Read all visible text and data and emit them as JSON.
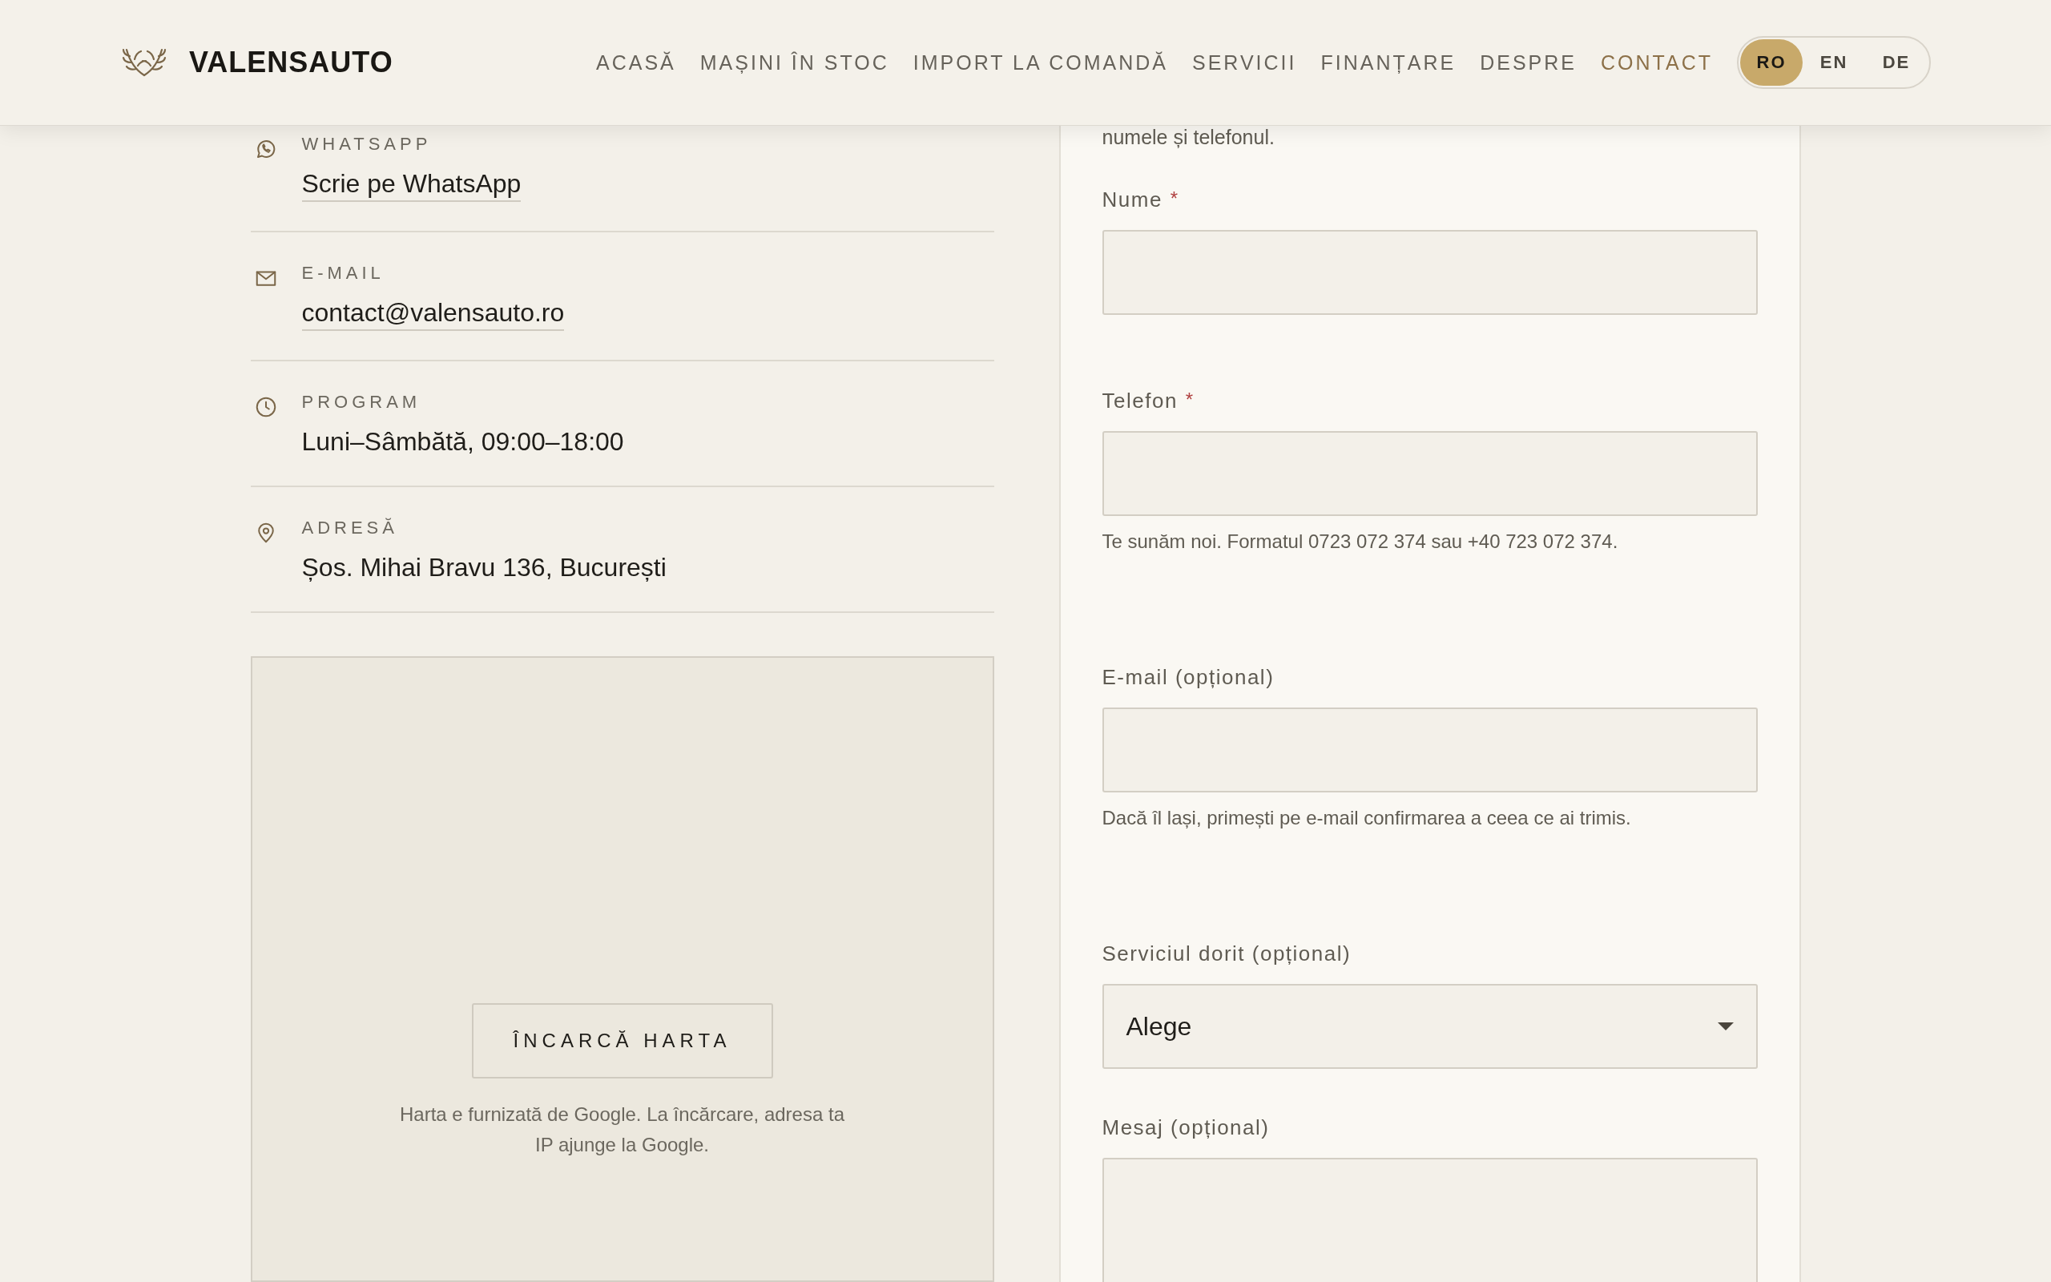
{
  "header": {
    "brand": "VALENSAUTO",
    "nav": [
      {
        "label": "ACASĂ",
        "selected": false
      },
      {
        "label": "MAȘINI ÎN STOC",
        "selected": false
      },
      {
        "label": "IMPORT LA COMANDĂ",
        "selected": false
      },
      {
        "label": "SERVICII",
        "selected": false
      },
      {
        "label": "FINANȚARE",
        "selected": false
      },
      {
        "label": "DESPRE",
        "selected": false
      },
      {
        "label": "CONTACT",
        "selected": true
      }
    ],
    "languages": [
      {
        "label": "RO",
        "selected": true
      },
      {
        "label": "EN",
        "selected": false
      },
      {
        "label": "DE",
        "selected": false
      }
    ]
  },
  "contact_items": [
    {
      "kind": "whatsapp",
      "label": "WHATSAPP",
      "value": "Scrie pe WhatsApp",
      "link": true
    },
    {
      "kind": "email",
      "label": "E-MAIL",
      "value": "contact@valensauto.ro",
      "link": true
    },
    {
      "kind": "clock",
      "label": "PROGRAM",
      "value": "Luni–Sâmbătă, 09:00–18:00",
      "link": false
    },
    {
      "kind": "pin",
      "label": "ADRESĂ",
      "value": "Șos. Mihai Bravu 136, București",
      "link": false
    }
  ],
  "map": {
    "button": "ÎNCARCĂ HARTA",
    "note": "Harta e furnizată de Google. La încărcare, adresa ta IP ajunge la Google."
  },
  "form": {
    "intro": "numele și telefonul.",
    "fields": [
      {
        "kind": "text",
        "label": "Nume",
        "required_mark": "*"
      },
      {
        "kind": "text",
        "label": "Telefon",
        "required_mark": "*",
        "hint": "Te sunăm noi. Formatul 0723 072 374 sau +40 723 072 374."
      },
      {
        "kind": "text",
        "label": "E-mail (opțional)",
        "hint": "Dacă îl lași, primești pe e-mail confirmarea a ceea ce ai trimis."
      },
      {
        "kind": "select",
        "label": "Serviciul dorit (opțional)",
        "value": "Alege"
      },
      {
        "kind": "textarea",
        "label": "Mesaj (opțional)"
      }
    ]
  }
}
